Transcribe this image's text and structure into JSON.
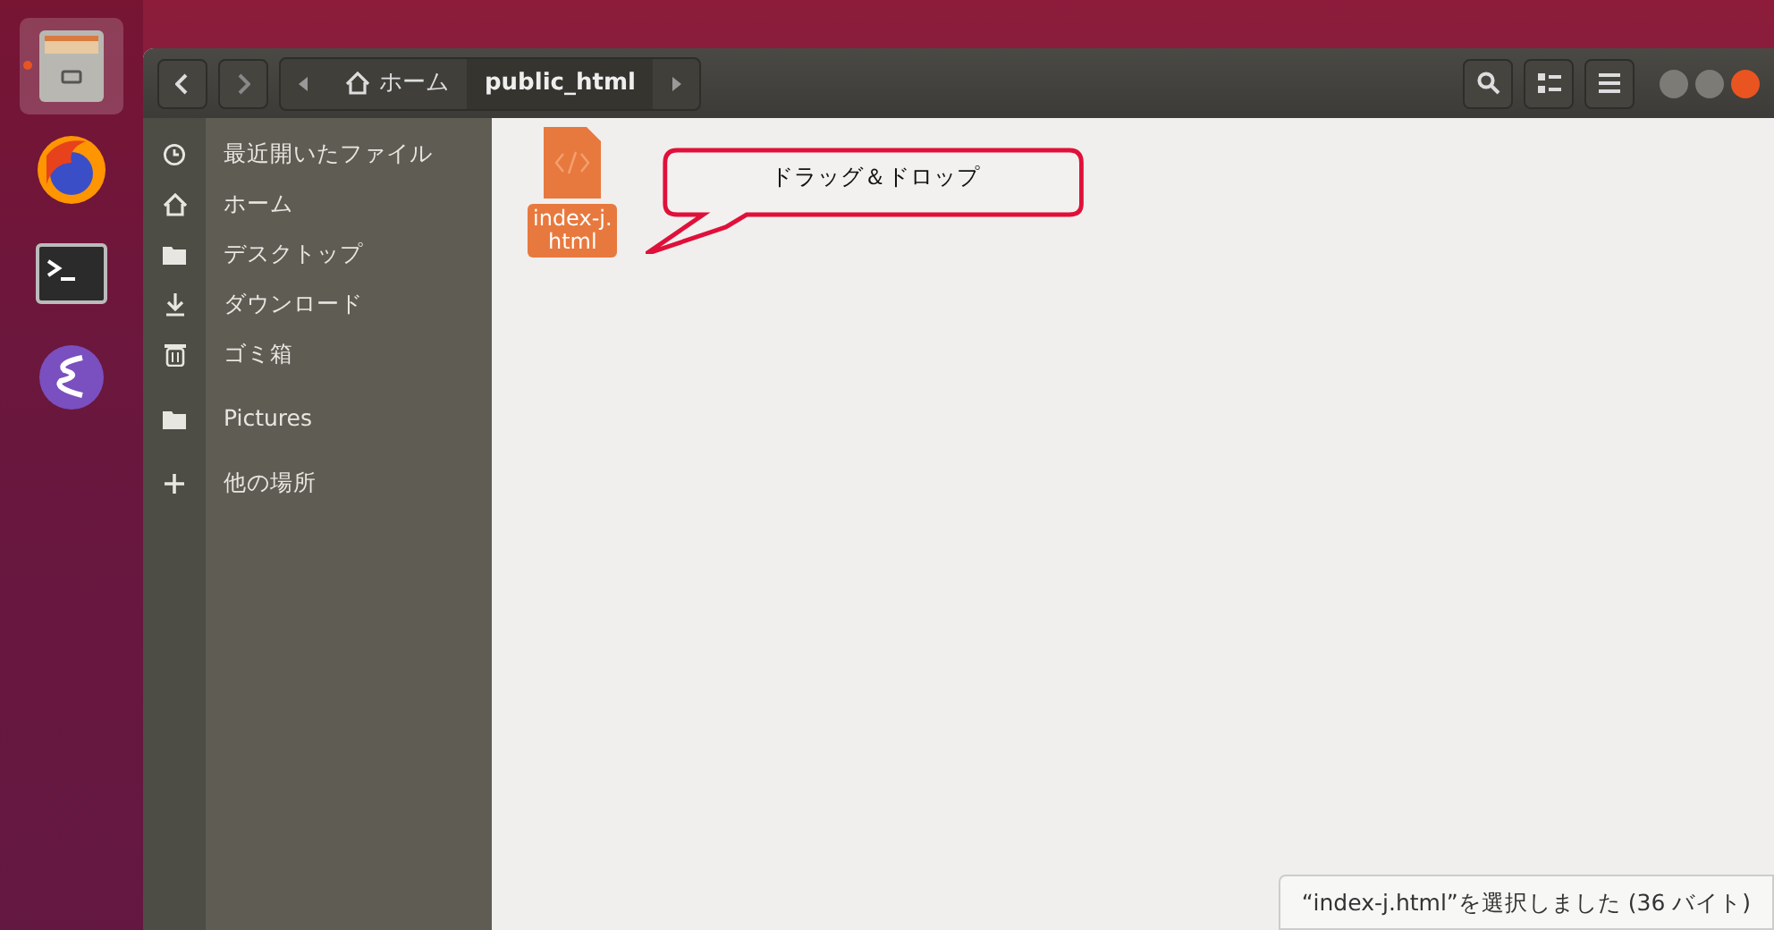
{
  "dock": {
    "items": [
      {
        "kind": "files",
        "selected": true
      },
      {
        "kind": "browser",
        "selected": false
      },
      {
        "kind": "terminal",
        "selected": false
      },
      {
        "kind": "editor",
        "selected": false
      }
    ]
  },
  "window": {
    "breadcrumbs": [
      {
        "label": "ホーム",
        "kind": "home",
        "selected": false
      },
      {
        "label": "public_html",
        "kind": "folder",
        "selected": true
      }
    ]
  },
  "sidebar": {
    "sections": [
      {
        "items": [
          {
            "label": "最近開いたファイル",
            "kind": "recent"
          },
          {
            "label": "ホーム",
            "kind": "home"
          },
          {
            "label": "デスクトップ",
            "kind": "folder"
          },
          {
            "label": "ダウンロード",
            "kind": "download"
          },
          {
            "label": "ゴミ箱",
            "kind": "trash"
          }
        ]
      },
      {
        "items": [
          {
            "label": "Pictures",
            "kind": "folder"
          }
        ]
      },
      {
        "items": [
          {
            "label": "他の場所",
            "kind": "add"
          }
        ]
      }
    ]
  },
  "files": [
    {
      "label_lines": [
        "index-j.",
        "html"
      ],
      "selected": true
    }
  ],
  "callout": {
    "text": "ドラッグ＆ドロップ"
  },
  "status_bar": "“index-j.html”を選択しました (36 バイト)"
}
